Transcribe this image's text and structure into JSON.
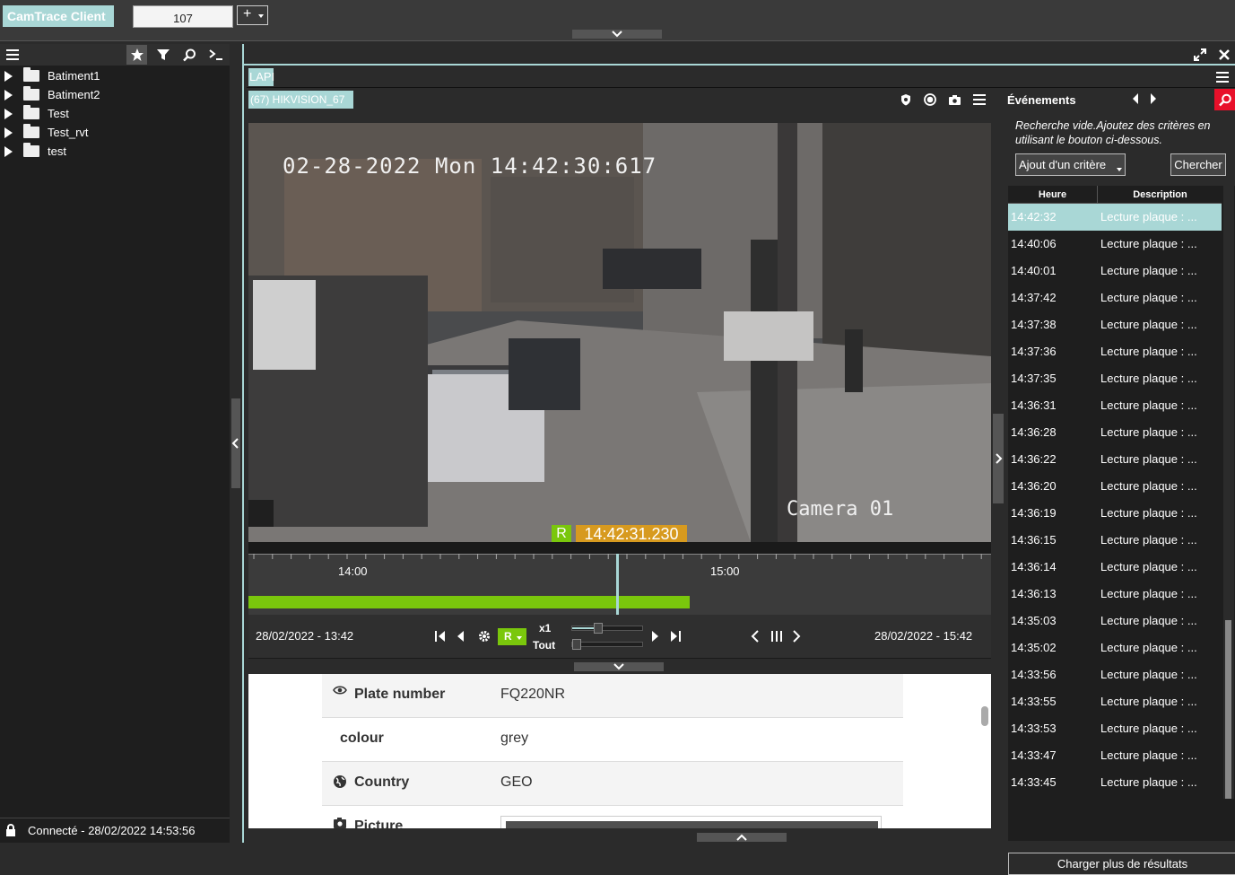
{
  "app": {
    "title": "CamTrace Client"
  },
  "tabs": [
    {
      "label": "107"
    }
  ],
  "add_tab_label": "+",
  "tree": [
    {
      "label": "Batiment1"
    },
    {
      "label": "Batiment2"
    },
    {
      "label": "Test"
    },
    {
      "label": "Test_rvt"
    },
    {
      "label": "test"
    }
  ],
  "status": {
    "text": "Connecté - 28/02/2022 14:53:56"
  },
  "view": {
    "tab": "LAPI",
    "camera_title": "(67) HIKVISION_67",
    "osd_datetime": "02-28-2022 Mon 14:42:30:617",
    "osd_camera": "Camera 01",
    "record_badge": "R",
    "current_time": "14:42:31.230"
  },
  "timeline": {
    "ticks": [
      {
        "label": "14:00"
      },
      {
        "label": "15:00"
      }
    ],
    "recorded_fraction": 0.594,
    "cursor_fraction": 0.495
  },
  "controls": {
    "start": "28/02/2022 - 13:42",
    "end": "28/02/2022 - 15:42",
    "mode": "R",
    "speed": "x1",
    "scope": "Tout"
  },
  "plate": {
    "rows": [
      {
        "key": "Plate number",
        "value": "FQ220NR",
        "icon": "eye-icon"
      },
      {
        "key": "colour",
        "value": "grey",
        "icon": ""
      },
      {
        "key": "Country",
        "value": "GEO",
        "icon": "globe-icon"
      },
      {
        "key": "Picture",
        "value": "",
        "icon": "camera-icon"
      }
    ]
  },
  "events": {
    "title": "Événements",
    "hint": "Recherche vide.Ajoutez des critères en utilisant le bouton ci-dessous.",
    "add_criteria": "Ajout d'un critère",
    "search_button": "Chercher",
    "columns": {
      "time": "Heure",
      "description": "Description"
    },
    "rows": [
      {
        "time": "14:42:32",
        "desc": "Lecture plaque : ...",
        "selected": true
      },
      {
        "time": "14:40:06",
        "desc": "Lecture plaque : ..."
      },
      {
        "time": "14:40:01",
        "desc": "Lecture plaque : ..."
      },
      {
        "time": "14:37:42",
        "desc": "Lecture plaque : ..."
      },
      {
        "time": "14:37:38",
        "desc": "Lecture plaque : ..."
      },
      {
        "time": "14:37:36",
        "desc": "Lecture plaque : ..."
      },
      {
        "time": "14:37:35",
        "desc": "Lecture plaque : ..."
      },
      {
        "time": "14:36:31",
        "desc": "Lecture plaque : ..."
      },
      {
        "time": "14:36:28",
        "desc": "Lecture plaque : ..."
      },
      {
        "time": "14:36:22",
        "desc": "Lecture plaque : ..."
      },
      {
        "time": "14:36:20",
        "desc": "Lecture plaque : ..."
      },
      {
        "time": "14:36:19",
        "desc": "Lecture plaque : ..."
      },
      {
        "time": "14:36:15",
        "desc": "Lecture plaque : ..."
      },
      {
        "time": "14:36:14",
        "desc": "Lecture plaque : ..."
      },
      {
        "time": "14:36:13",
        "desc": "Lecture plaque : ..."
      },
      {
        "time": "14:35:03",
        "desc": "Lecture plaque : ..."
      },
      {
        "time": "14:35:02",
        "desc": "Lecture plaque : ..."
      },
      {
        "time": "14:33:56",
        "desc": "Lecture plaque : ..."
      },
      {
        "time": "14:33:55",
        "desc": "Lecture plaque : ..."
      },
      {
        "time": "14:33:53",
        "desc": "Lecture plaque : ..."
      },
      {
        "time": "14:33:47",
        "desc": "Lecture plaque : ..."
      },
      {
        "time": "14:33:45",
        "desc": "Lecture plaque : ..."
      }
    ],
    "load_more": "Charger plus de résultats"
  },
  "colors": {
    "accent": "#a9d7d6",
    "record_green": "#7ac70c",
    "time_orange": "#d79a1f",
    "search_red": "#e8102a"
  }
}
